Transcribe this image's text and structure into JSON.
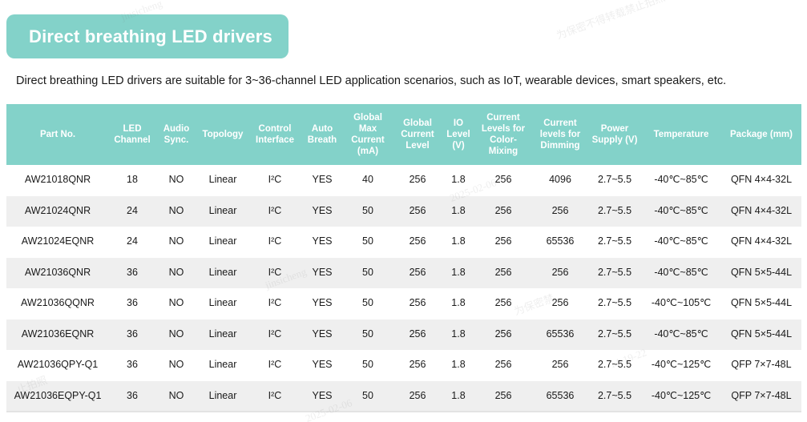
{
  "header": {
    "title": "Direct breathing LED drivers",
    "subtitle": "Direct breathing LED drivers are suitable for 3~36-channel LED application scenarios, such as IoT, wearable devices, smart speakers, etc."
  },
  "colors": {
    "accent_teal": "#83d2c9",
    "header_text": "#ffffff",
    "row_even_bg": "#efefef",
    "row_odd_bg": "#ffffff",
    "body_text": "#1a1a1a"
  },
  "table": {
    "columns": [
      "Part No.",
      "LED Channel",
      "Audio Sync.",
      "Topology",
      "Control Interface",
      "Auto Breath",
      "Global Max Current (mA)",
      "Global Current Level",
      "IO Level (V)",
      "Current Levels for Color-Mixing",
      "Current levels for Dimming",
      "Power Supply (V)",
      "Temperature",
      "Package (mm)"
    ],
    "rows": [
      {
        "part_no": "AW21018QNR",
        "led_channel": "18",
        "audio_sync": "NO",
        "topology": "Linear",
        "control_interface": "I²C",
        "auto_breath": "YES",
        "global_max_current": "40",
        "global_current_level": "256",
        "io_level": "1.8",
        "current_levels_color_mixing": "256",
        "current_levels_dimming": "4096",
        "power_supply": "2.7~5.5",
        "temperature": "-40℃~85℃",
        "package": "QFN 4×4-32L"
      },
      {
        "part_no": "AW21024QNR",
        "led_channel": "24",
        "audio_sync": "NO",
        "topology": "Linear",
        "control_interface": "I²C",
        "auto_breath": "YES",
        "global_max_current": "50",
        "global_current_level": "256",
        "io_level": "1.8",
        "current_levels_color_mixing": "256",
        "current_levels_dimming": "256",
        "power_supply": "2.7~5.5",
        "temperature": "-40℃~85℃",
        "package": "QFN 4×4-32L"
      },
      {
        "part_no": "AW21024EQNR",
        "led_channel": "24",
        "audio_sync": "NO",
        "topology": "Linear",
        "control_interface": "I²C",
        "auto_breath": "YES",
        "global_max_current": "50",
        "global_current_level": "256",
        "io_level": "1.8",
        "current_levels_color_mixing": "256",
        "current_levels_dimming": "65536",
        "power_supply": "2.7~5.5",
        "temperature": "-40℃~85℃",
        "package": "QFN 4×4-32L"
      },
      {
        "part_no": "AW21036QNR",
        "led_channel": "36",
        "audio_sync": "NO",
        "topology": "Linear",
        "control_interface": "I²C",
        "auto_breath": "YES",
        "global_max_current": "50",
        "global_current_level": "256",
        "io_level": "1.8",
        "current_levels_color_mixing": "256",
        "current_levels_dimming": "256",
        "power_supply": "2.7~5.5",
        "temperature": "-40℃~85℃",
        "package": "QFN 5×5-44L"
      },
      {
        "part_no": "AW21036QQNR",
        "led_channel": "36",
        "audio_sync": "NO",
        "topology": "Linear",
        "control_interface": "I²C",
        "auto_breath": "YES",
        "global_max_current": "50",
        "global_current_level": "256",
        "io_level": "1.8",
        "current_levels_color_mixing": "256",
        "current_levels_dimming": "256",
        "power_supply": "2.7~5.5",
        "temperature": "-40℃~105℃",
        "package": "QFN 5×5-44L"
      },
      {
        "part_no": "AW21036EQNR",
        "led_channel": "36",
        "audio_sync": "NO",
        "topology": "Linear",
        "control_interface": "I²C",
        "auto_breath": "YES",
        "global_max_current": "50",
        "global_current_level": "256",
        "io_level": "1.8",
        "current_levels_color_mixing": "256",
        "current_levels_dimming": "65536",
        "power_supply": "2.7~5.5",
        "temperature": "-40℃~85℃",
        "package": "QFN 5×5-44L"
      },
      {
        "part_no": "AW21036QPY-Q1",
        "led_channel": "36",
        "audio_sync": "NO",
        "topology": "Linear",
        "control_interface": "I²C",
        "auto_breath": "YES",
        "global_max_current": "50",
        "global_current_level": "256",
        "io_level": "1.8",
        "current_levels_color_mixing": "256",
        "current_levels_dimming": "256",
        "power_supply": "2.7~5.5",
        "temperature": "-40℃~125℃",
        "package": "QFP 7×7-48L"
      },
      {
        "part_no": "AW21036EQPY-Q1",
        "led_channel": "36",
        "audio_sync": "NO",
        "topology": "Linear",
        "control_interface": "I²C",
        "auto_breath": "YES",
        "global_max_current": "50",
        "global_current_level": "256",
        "io_level": "1.8",
        "current_levels_color_mixing": "256",
        "current_levels_dimming": "65536",
        "power_supply": "2.7~5.5",
        "temperature": "-40℃~125℃",
        "package": "QFP 7×7-48L"
      }
    ]
  }
}
